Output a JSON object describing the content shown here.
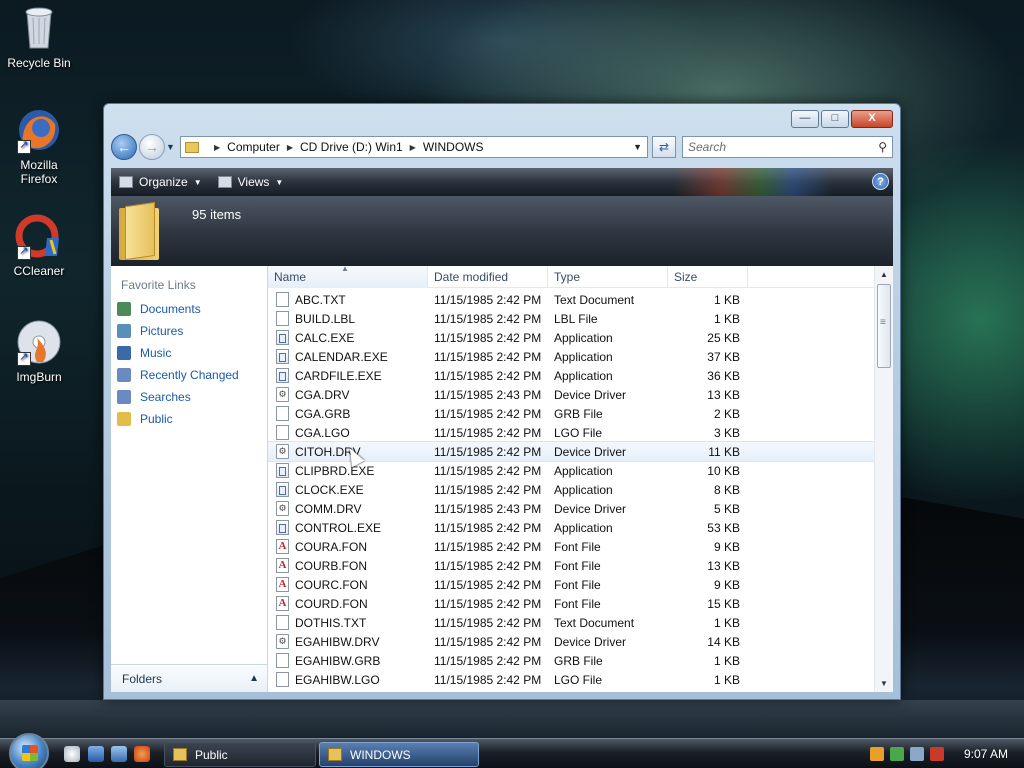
{
  "desktop": {
    "icons": [
      {
        "label": "Recycle Bin",
        "icon": "recycle-bin-icon"
      },
      {
        "label": "Mozilla Firefox",
        "icon": "firefox-icon"
      },
      {
        "label": "CCleaner",
        "icon": "ccleaner-icon"
      },
      {
        "label": "ImgBurn",
        "icon": "imgburn-icon"
      }
    ]
  },
  "window": {
    "controls": {
      "minimize": "—",
      "maximize": "□",
      "close": "X"
    },
    "address": {
      "crumbs": [
        "Computer",
        "CD Drive (D:) Win1",
        "WINDOWS"
      ]
    },
    "search_placeholder": "Search",
    "toolbar": {
      "organize": "Organize",
      "views": "Views",
      "help": "?"
    },
    "header": {
      "item_count": "95 items"
    },
    "favorite_links": {
      "title": "Favorite Links",
      "items": [
        {
          "label": "Documents",
          "color": "#4d8a5a"
        },
        {
          "label": "Pictures",
          "color": "#5a8fb8"
        },
        {
          "label": "Music",
          "color": "#3a6aa8"
        },
        {
          "label": "Recently Changed",
          "color": "#6a8ac0"
        },
        {
          "label": "Searches",
          "color": "#6a8ac0"
        },
        {
          "label": "Public",
          "color": "#e3bd4a"
        }
      ]
    },
    "folders_label": "Folders",
    "columns": {
      "name": "Name",
      "date": "Date modified",
      "type": "Type",
      "size": "Size"
    },
    "files": [
      {
        "name": "ABC.TXT",
        "date": "11/15/1985 2:42 PM",
        "type": "Text Document",
        "size": "1 KB",
        "icon": "text-file-icon"
      },
      {
        "name": "BUILD.LBL",
        "date": "11/15/1985 2:42 PM",
        "type": "LBL File",
        "size": "1 KB",
        "icon": "generic-file-icon"
      },
      {
        "name": "CALC.EXE",
        "date": "11/15/1985 2:42 PM",
        "type": "Application",
        "size": "25 KB",
        "icon": "application-icon"
      },
      {
        "name": "CALENDAR.EXE",
        "date": "11/15/1985 2:42 PM",
        "type": "Application",
        "size": "37 KB",
        "icon": "application-icon"
      },
      {
        "name": "CARDFILE.EXE",
        "date": "11/15/1985 2:42 PM",
        "type": "Application",
        "size": "36 KB",
        "icon": "application-icon"
      },
      {
        "name": "CGA.DRV",
        "date": "11/15/1985 2:43 PM",
        "type": "Device Driver",
        "size": "13 KB",
        "icon": "driver-icon"
      },
      {
        "name": "CGA.GRB",
        "date": "11/15/1985 2:42 PM",
        "type": "GRB File",
        "size": "2 KB",
        "icon": "generic-file-icon"
      },
      {
        "name": "CGA.LGO",
        "date": "11/15/1985 2:42 PM",
        "type": "LGO File",
        "size": "3 KB",
        "icon": "generic-file-icon"
      },
      {
        "name": "CITOH.DRV",
        "date": "11/15/1985 2:42 PM",
        "type": "Device Driver",
        "size": "11 KB",
        "icon": "driver-icon"
      },
      {
        "name": "CLIPBRD.EXE",
        "date": "11/15/1985 2:42 PM",
        "type": "Application",
        "size": "10 KB",
        "icon": "application-icon"
      },
      {
        "name": "CLOCK.EXE",
        "date": "11/15/1985 2:42 PM",
        "type": "Application",
        "size": "8 KB",
        "icon": "application-icon"
      },
      {
        "name": "COMM.DRV",
        "date": "11/15/1985 2:43 PM",
        "type": "Device Driver",
        "size": "5 KB",
        "icon": "driver-icon"
      },
      {
        "name": "CONTROL.EXE",
        "date": "11/15/1985 2:42 PM",
        "type": "Application",
        "size": "53 KB",
        "icon": "application-icon"
      },
      {
        "name": "COURA.FON",
        "date": "11/15/1985 2:42 PM",
        "type": "Font File",
        "size": "9 KB",
        "icon": "font-file-icon"
      },
      {
        "name": "COURB.FON",
        "date": "11/15/1985 2:42 PM",
        "type": "Font File",
        "size": "13 KB",
        "icon": "font-file-icon"
      },
      {
        "name": "COURC.FON",
        "date": "11/15/1985 2:42 PM",
        "type": "Font File",
        "size": "9 KB",
        "icon": "font-file-icon"
      },
      {
        "name": "COURD.FON",
        "date": "11/15/1985 2:42 PM",
        "type": "Font File",
        "size": "15 KB",
        "icon": "font-file-icon"
      },
      {
        "name": "DOTHIS.TXT",
        "date": "11/15/1985 2:42 PM",
        "type": "Text Document",
        "size": "1 KB",
        "icon": "text-file-icon"
      },
      {
        "name": "EGAHIBW.DRV",
        "date": "11/15/1985 2:42 PM",
        "type": "Device Driver",
        "size": "14 KB",
        "icon": "driver-icon"
      },
      {
        "name": "EGAHIBW.GRB",
        "date": "11/15/1985 2:42 PM",
        "type": "GRB File",
        "size": "1 KB",
        "icon": "generic-file-icon"
      },
      {
        "name": "EGAHIBW.LGO",
        "date": "11/15/1985 2:42 PM",
        "type": "LGO File",
        "size": "1 KB",
        "icon": "generic-file-icon"
      }
    ]
  },
  "taskbar": {
    "buttons": [
      {
        "label": "Public"
      },
      {
        "label": "WINDOWS"
      }
    ],
    "clock": "9:07 AM"
  }
}
